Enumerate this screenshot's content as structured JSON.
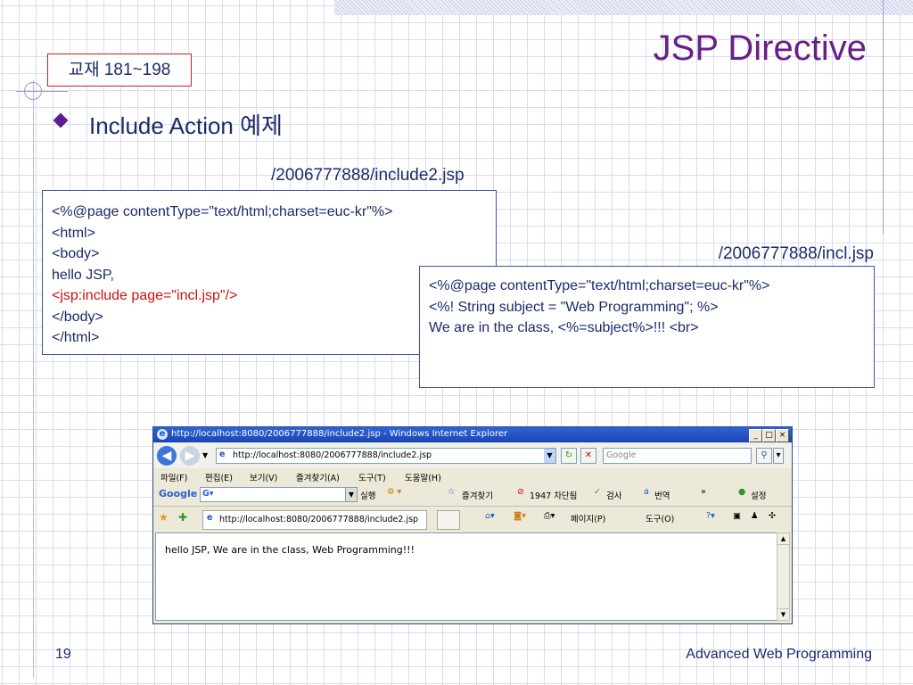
{
  "slide": {
    "title": "JSP Directive",
    "book_ref": "교재 181~198",
    "bullet": "Include Action 예제",
    "page_number": "19",
    "footer": "Advanced Web Programming"
  },
  "file1": {
    "label": "/2006777888/include2.jsp",
    "lines": [
      "<%@page contentType=\"text/html;charset=euc-kr\"%>",
      "<html>",
      "<body>",
      "hello JSP,",
      "<jsp:include page=\"incl.jsp\"/>",
      "</body>",
      "</html>"
    ]
  },
  "file2": {
    "label": "/2006777888/incl.jsp",
    "lines": [
      "<%@page contentType=\"text/html;charset=euc-kr\"%>",
      "<%! String subject = \"Web Programming\"; %>",
      "We are in the class, <%=subject%>!!! <br>"
    ]
  },
  "browser": {
    "window_title": "http://localhost:8080/2006777888/include2.jsp - Windows Internet Explorer",
    "address": "http://localhost:8080/2006777888/include2.jsp",
    "search_placeholder": "Google",
    "menu": [
      "파일(F)",
      "편집(E)",
      "보기(V)",
      "즐겨찾기(A)",
      "도구(T)",
      "도움말(H)"
    ],
    "google_bar": {
      "logo": "Google",
      "run": "실행",
      "favorites": "즐겨찾기",
      "blocked": "1947 차단됨",
      "check": "검사",
      "translate": "번역",
      "settings": "설정"
    },
    "tab_title": "http://localhost:8080/2006777888/include2.jsp",
    "cmd": {
      "page": "페이지(P)",
      "tools": "도구(O)"
    },
    "page_content": "hello JSP, We are in the class, Web Programming!!!"
  }
}
